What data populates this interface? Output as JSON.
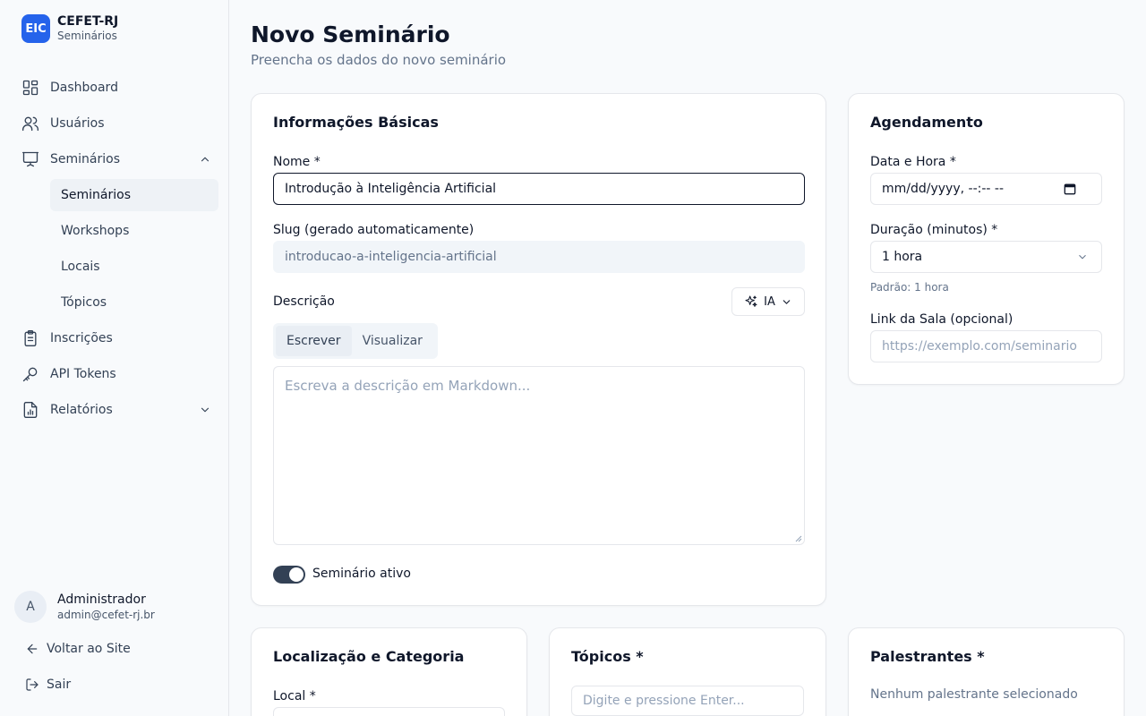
{
  "brand": {
    "logo": "EIC",
    "name": "CEFET-RJ",
    "subtitle": "Seminários"
  },
  "nav": {
    "dashboard": "Dashboard",
    "usuarios": "Usuários",
    "seminarios": "Seminários",
    "sub": [
      "Seminários",
      "Workshops",
      "Locais",
      "Tópicos"
    ],
    "inscricoes": "Inscrições",
    "api_tokens": "API Tokens",
    "relatorios": "Relatórios"
  },
  "user": {
    "initial": "A",
    "name": "Administrador",
    "email": "admin@cefet-rj.br"
  },
  "footer": {
    "back": "Voltar ao Site",
    "logout": "Sair"
  },
  "page": {
    "title": "Novo Seminário",
    "subtitle": "Preencha os dados do novo seminário"
  },
  "basic": {
    "title": "Informações Básicas",
    "name_label": "Nome *",
    "name_value": "Introdução à Inteligência Artificial",
    "slug_label": "Slug (gerado automaticamente)",
    "slug_value": "introducao-a-inteligencia-artificial",
    "desc_label": "Descrição",
    "ia_label": "IA",
    "tab_write": "Escrever",
    "tab_preview": "Visualizar",
    "desc_placeholder": "Escreva a descrição em Markdown...",
    "active_label": "Seminário ativo"
  },
  "schedule": {
    "title": "Agendamento",
    "date_label": "Data e Hora *",
    "date_value": "mm/dd/yyyy, --:-- --",
    "duration_label": "Duração (minutos) *",
    "duration_value": "1 hora",
    "duration_hint": "Padrão: 1 hora",
    "link_label": "Link da Sala (opcional)",
    "link_placeholder": "https://exemplo.com/seminario"
  },
  "location": {
    "title": "Localização e Categoria",
    "local_label": "Local *"
  },
  "topics": {
    "title": "Tópicos *",
    "placeholder": "Digite e pressione Enter..."
  },
  "speakers": {
    "title": "Palestrantes *",
    "empty": "Nenhum palestrante selecionado"
  },
  "colors": {
    "accent": "#2563eb",
    "toggle_on": "#334155"
  }
}
